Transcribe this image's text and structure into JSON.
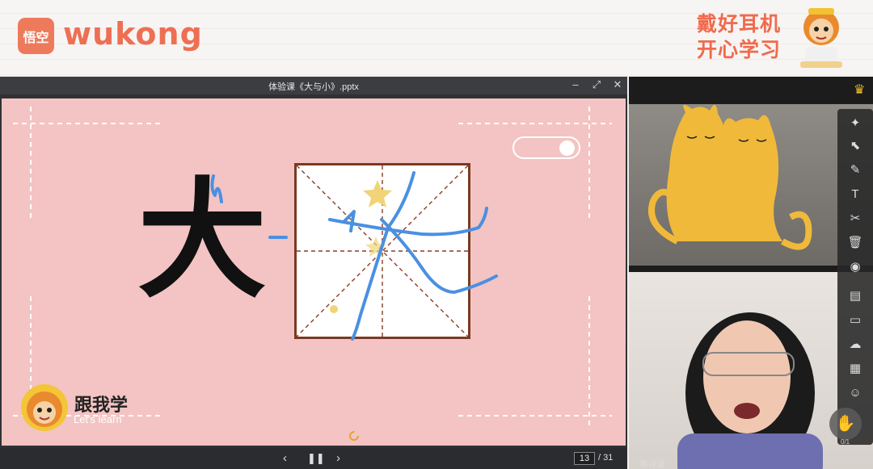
{
  "banner": {
    "logo_mark": "悟空",
    "logo_text": "wukong",
    "slogan_line1": "戴好耳机",
    "slogan_line2": "开心学习"
  },
  "window": {
    "title": "体验课《大与小》.pptx",
    "minimize_icon": "minimize-icon",
    "restore_icon": "restore-icon",
    "close_icon": "close-icon"
  },
  "slide": {
    "character": "大",
    "follow_title": "跟我学",
    "follow_subtitle": "Let's learn",
    "background_color": "#f3c4c3",
    "grid_border_color": "#7a3a22",
    "annotation_color": "#4a90e2"
  },
  "controls": {
    "prev_icon": "chevron-left-icon",
    "pause_icon": "pause-icon",
    "next_icon": "chevron-right-icon",
    "current_page": "13",
    "total_pages": "/ 31"
  },
  "right_panel": {
    "teacher_name": "陈诗涵",
    "hand_count": "0/1",
    "tools": [
      "laser-pointer-icon",
      "select-icon",
      "pen-icon",
      "text-icon",
      "scissors-icon",
      "trash-icon",
      "eye-icon",
      "formula-icon",
      "chat-icon",
      "cloud-icon",
      "toolbox-icon",
      "users-icon"
    ]
  }
}
